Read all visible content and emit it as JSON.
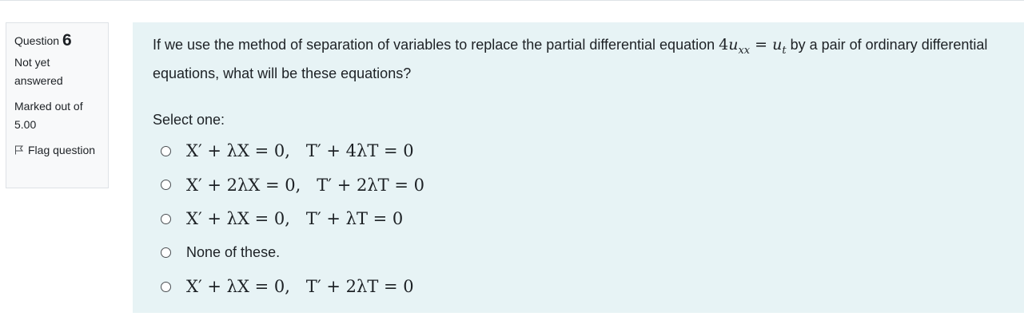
{
  "question": {
    "label": "Question",
    "number": "6",
    "state": "Not yet answered",
    "grade": "Marked out of 5.00",
    "flag_label": "Flag question"
  },
  "content": {
    "text_before": "If we use the method of separation of variables to replace the partial differential equation ",
    "equation_coefficient": "4",
    "equation_var": "u",
    "equation_sub_left": "xx",
    "equation_equals": " = ",
    "equation_rhs_var": "u",
    "equation_sub_right": "t",
    "text_after": " by a pair of  ordinary differential equations, what will be these equations?",
    "prompt": "Select one:",
    "answers": [
      "X′ + λX = 0,   T′ + 4λT = 0",
      "X′ + 2λX = 0,   T′ + 2λT = 0",
      "X′ + λX = 0,   T′ + λT = 0",
      "None of these.",
      "X′ + λX = 0,   T′ + 2λT = 0"
    ]
  },
  "colors": {
    "info_background": "#f8f9fa",
    "content_background": "#e7f3f5",
    "text": "#1d2125",
    "border": "#dee2e6"
  },
  "icons": {
    "flag": "flag-outline-icon",
    "radio": "radio-unchecked-icon"
  }
}
